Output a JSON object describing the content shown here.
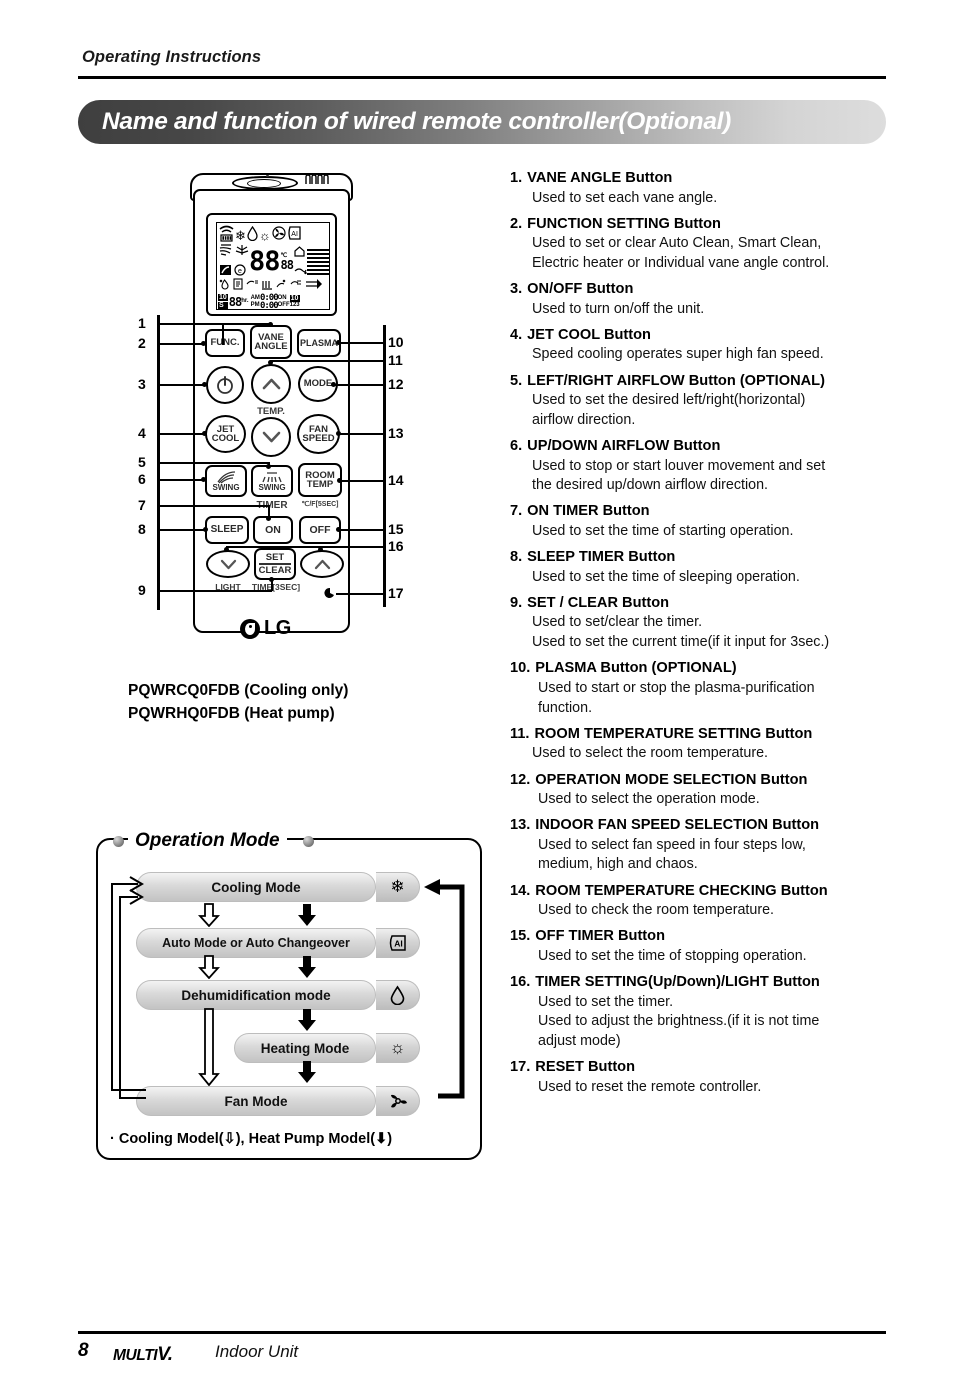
{
  "header": {
    "running_head": "Operating Instructions",
    "section_title": "Name and function of wired remote controller(Optional)"
  },
  "remote": {
    "models": [
      "PQWRCQ0FDB (Cooling only)",
      "PQWRHQ0FDB (Heat pump)"
    ],
    "brand": "LG",
    "buttons": {
      "func": "FUNC.",
      "vane_angle_l1": "VANE",
      "vane_angle_l2": "ANGLE",
      "plasma": "PLASMA",
      "mode": "MODE",
      "jet_l1": "JET",
      "jet_l2": "COOL",
      "fan_l1": "FAN",
      "fan_l2": "SPEED",
      "swing_lr": "SWING",
      "swing_ud": "SWING",
      "room_l1": "ROOM",
      "room_l2": "TEMP",
      "sleep": "SLEEP",
      "on": "ON",
      "off": "OFF",
      "set": "SET",
      "clear": "CLEAR"
    },
    "sub_labels": {
      "temp": "TEMP.",
      "timer": "TIMER",
      "celsius_fahrenheit": "℃/F[5SEC]",
      "light": "LIGHT",
      "time_3sec": "TIME[3SEC]"
    },
    "lcd": {
      "am": "AM",
      "pm": "PM",
      "hr": "hr.",
      "on": "ON",
      "off": "OFF",
      "one_two_three": "123",
      "digits_big": "88",
      "digits_small": "88",
      "time_digits": "0:00",
      "time_digits2": "0:00",
      "unit_c": "℃",
      "ai": "AI",
      "badge_10": "10",
      "badge_s": "S"
    },
    "callouts_left": [
      "1",
      "2",
      "3",
      "4",
      "5",
      "6",
      "7",
      "8",
      "9"
    ],
    "callouts_right": [
      "10",
      "11",
      "12",
      "13",
      "14",
      "15",
      "16",
      "17"
    ]
  },
  "operation_mode": {
    "title": "Operation Mode",
    "steps": [
      {
        "label": "Cooling Mode",
        "icon": "snowflake-icon"
      },
      {
        "label": "Auto Mode or Auto Changeover",
        "icon": "ai-icon"
      },
      {
        "label": "Dehumidification mode",
        "icon": "droplet-icon"
      },
      {
        "label": "Heating Mode",
        "icon": "sun-icon"
      },
      {
        "label": "Fan Mode",
        "icon": "fan-icon"
      }
    ],
    "caption": "· Cooling Model(⇩), Heat Pump Model(⬇)"
  },
  "descriptions": [
    {
      "num": "1.",
      "title": "VANE ANGLE Button",
      "lines": [
        "Used to set each vane angle."
      ]
    },
    {
      "num": "2.",
      "title": "FUNCTION SETTING Button",
      "lines": [
        "Used to set or clear Auto Clean, Smart Clean,",
        "Electric heater or Individual vane angle control."
      ]
    },
    {
      "num": "3.",
      "title": "ON/OFF Button",
      "lines": [
        "Used to turn on/off the unit."
      ]
    },
    {
      "num": "4.",
      "title": "JET COOL Button",
      "lines": [
        "Speed cooling operates super high fan speed."
      ]
    },
    {
      "num": "5.",
      "title": "LEFT/RIGHT AIRFLOW Button (OPTIONAL)",
      "lines": [
        "Used to set the desired left/right(horizontal)",
        "airflow direction."
      ]
    },
    {
      "num": "6.",
      "title": "UP/DOWN AIRFLOW Button",
      "lines": [
        "Used to stop or start louver movement and set",
        "the desired up/down airflow direction."
      ]
    },
    {
      "num": "7.",
      "title": "ON TIMER Button",
      "lines": [
        "Used to set the time of starting operation."
      ]
    },
    {
      "num": "8.",
      "title": "SLEEP TIMER Button",
      "lines": [
        "Used to set the time of sleeping operation."
      ]
    },
    {
      "num": "9.",
      "title": "SET / CLEAR Button",
      "lines": [
        "Used to set/clear the timer.",
        "Used to set the current time(if it input for 3sec.)"
      ]
    },
    {
      "num": "10.",
      "title": "PLASMA Button (OPTIONAL)",
      "lines": [
        "Used to start or stop the plasma-purification",
        "function."
      ]
    },
    {
      "num": "11.",
      "title": "ROOM TEMPERATURE SETTING Button",
      "lines": [
        "Used to select the room temperature."
      ]
    },
    {
      "num": "12.",
      "title": "OPERATION MODE SELECTION Button",
      "lines": [
        "Used to select the operation mode."
      ]
    },
    {
      "num": "13.",
      "title": "INDOOR FAN SPEED SELECTION Button",
      "lines": [
        "Used to select fan speed in four steps low,",
        "medium, high and chaos."
      ]
    },
    {
      "num": "14.",
      "title": "ROOM TEMPERATURE CHECKING Button",
      "lines": [
        "Used to check the room temperature."
      ]
    },
    {
      "num": "15.",
      "title": "OFF TIMER Button",
      "lines": [
        "Used to set the time of stopping operation."
      ]
    },
    {
      "num": "16.",
      "title": "TIMER SETTING(Up/Down)/LIGHT Button",
      "lines": [
        "Used to set the timer.",
        "Used to adjust the brightness.(if it is not time",
        "adjust mode)"
      ]
    },
    {
      "num": "17.",
      "title": "RESET Button",
      "lines": [
        "Used to reset the remote controller."
      ]
    }
  ],
  "footer": {
    "page_number": "8",
    "brand_multi": "MULTI",
    "brand_v": "V.",
    "unit_label": "Indoor Unit"
  },
  "colors": {
    "title_bar_dark": "#3f3f3f",
    "title_bar_light": "#dddddd",
    "ink": "#000000"
  }
}
